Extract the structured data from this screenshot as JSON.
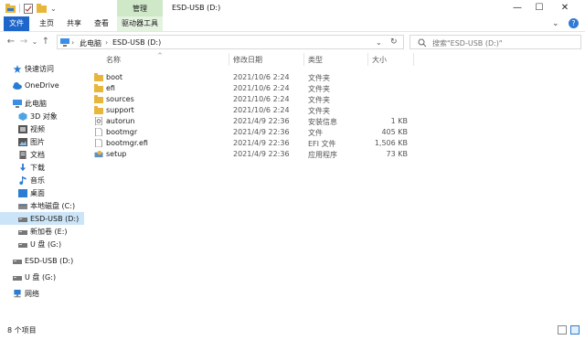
{
  "titlebar": {
    "title": "ESD-USB (D:)",
    "context_group": "管理",
    "min": "—",
    "max": "☐",
    "close": "✕"
  },
  "ribbon": {
    "tabs": [
      "文件",
      "主页",
      "共享",
      "查看",
      "驱动器工具"
    ],
    "expand": "⌄",
    "help": "?"
  },
  "address": {
    "crumbs": [
      "此电脑",
      "ESD-USB (D:)"
    ],
    "dropdown": "⌄",
    "refresh": "↻",
    "search_placeholder": "搜索\"ESD-USB (D:)\""
  },
  "nav": {
    "back": "←",
    "forward": "→",
    "recent": "⌄",
    "up": "↑"
  },
  "sidebar": {
    "items": [
      {
        "label": "快速访问",
        "icon": "star-icon",
        "color": "#2b7cd3"
      },
      {
        "label": "OneDrive",
        "icon": "cloud-icon",
        "color": "#2b7cd3"
      },
      {
        "label": "此电脑",
        "icon": "computer-icon",
        "color": "#3a8ee6"
      },
      {
        "label": "3D 对象",
        "icon": "cube-icon",
        "color": "#4fa3e3"
      },
      {
        "label": "视频",
        "icon": "video-icon",
        "color": "#555555"
      },
      {
        "label": "图片",
        "icon": "pictures-icon",
        "color": "#555555"
      },
      {
        "label": "文档",
        "icon": "documents-icon",
        "color": "#555555"
      },
      {
        "label": "下载",
        "icon": "download-icon",
        "color": "#2b7cd3"
      },
      {
        "label": "音乐",
        "icon": "music-icon",
        "color": "#2b7cd3"
      },
      {
        "label": "桌面",
        "icon": "desktop-icon",
        "color": "#2b7cd3"
      },
      {
        "label": "本地磁盘 (C:)",
        "icon": "drive-icon",
        "color": "#666666"
      },
      {
        "label": "ESD-USB (D:)",
        "icon": "usb-drive-icon",
        "color": "#666666"
      },
      {
        "label": "新加卷 (E:)",
        "icon": "drive-icon",
        "color": "#666666"
      },
      {
        "label": "U 盘 (G:)",
        "icon": "usb-drive-icon",
        "color": "#666666"
      },
      {
        "label": "ESD-USB (D:)",
        "icon": "usb-drive-icon",
        "color": "#666666"
      },
      {
        "label": "U 盘 (G:)",
        "icon": "usb-drive-icon",
        "color": "#666666"
      },
      {
        "label": "网络",
        "icon": "network-icon",
        "color": "#2b7cd3"
      }
    ]
  },
  "columns": {
    "name": "名称",
    "date": "修改日期",
    "type": "类型",
    "size": "大小",
    "sort_caret": "^"
  },
  "files": [
    {
      "name": "boot",
      "date": "2021/10/6 2:24",
      "type": "文件夹",
      "size": "",
      "icon": "folder-icon"
    },
    {
      "name": "efi",
      "date": "2021/10/6 2:24",
      "type": "文件夹",
      "size": "",
      "icon": "folder-icon"
    },
    {
      "name": "sources",
      "date": "2021/10/6 2:24",
      "type": "文件夹",
      "size": "",
      "icon": "folder-icon"
    },
    {
      "name": "support",
      "date": "2021/10/6 2:24",
      "type": "文件夹",
      "size": "",
      "icon": "folder-icon"
    },
    {
      "name": "autorun",
      "date": "2021/4/9 22:36",
      "type": "安装信息",
      "size": "1 KB",
      "icon": "setup-info-icon"
    },
    {
      "name": "bootmgr",
      "date": "2021/4/9 22:36",
      "type": "文件",
      "size": "405 KB",
      "icon": "file-icon"
    },
    {
      "name": "bootmgr.efi",
      "date": "2021/4/9 22:36",
      "type": "EFI 文件",
      "size": "1,506 KB",
      "icon": "file-icon"
    },
    {
      "name": "setup",
      "date": "2021/4/9 22:36",
      "type": "应用程序",
      "size": "73 KB",
      "icon": "setup-app-icon"
    }
  ],
  "status": {
    "count": "8 个项目"
  },
  "colors": {
    "accent": "#1e66c9",
    "folder": "#e8b63a",
    "context_tab": "#cfe8c8",
    "selection": "#cce4f7"
  }
}
